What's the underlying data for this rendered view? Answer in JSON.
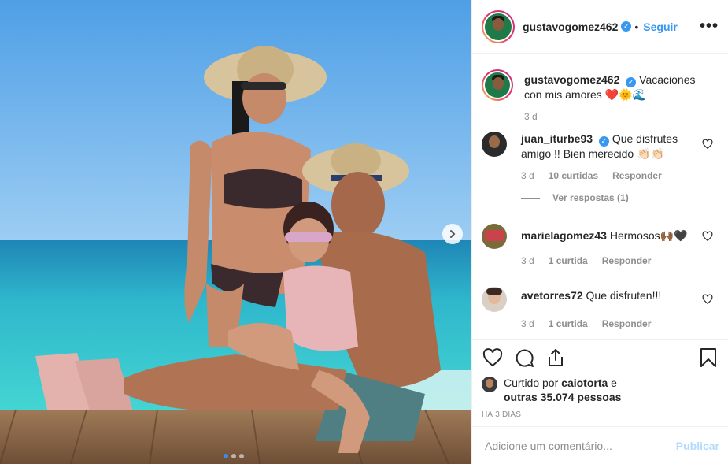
{
  "post": {
    "username": "gustavogomez462",
    "verified_icon": "verified-badge-icon",
    "follow_label": "Seguir",
    "separator": "•",
    "more_label": "•••"
  },
  "caption": {
    "username": "gustavogomez462",
    "text": "Vacaciones con mis amores",
    "emoji": "❤️🌞🌊",
    "time": "3 d"
  },
  "comments": [
    {
      "username": "juan_iturbe93",
      "text": "Que disfrutes amigo !! Bien merecido 👏🏻👏🏻",
      "time": "3 d",
      "likes": "10 curtidas",
      "reply_label": "Responder",
      "view_replies": "Ver respostas (1)"
    },
    {
      "username": "marielagomez43",
      "text": "Hermosos🙌🏾🖤",
      "time": "3 d",
      "likes": "1 curtida",
      "reply_label": "Responder"
    },
    {
      "username": "avetorres72",
      "text": "Que disfruten!!!",
      "time": "3 d",
      "likes": "1 curtida",
      "reply_label": "Responder"
    }
  ],
  "likes": {
    "prefix": "Curtido por",
    "user": "caiotorta",
    "middle": "e",
    "others": "outras 35.074 pessoas"
  },
  "posted_time": "HÁ 3 DIAS",
  "add_comment": {
    "placeholder": "Adicione um comentário...",
    "publish_label": "Publicar"
  },
  "colors": {
    "accent": "#3897f0",
    "publish_disabled": "#b3dbff",
    "muted": "#8e8e8e",
    "text": "#262626",
    "heart_red": "#ed4956"
  },
  "carousel": {
    "current": 1,
    "total": 3
  }
}
